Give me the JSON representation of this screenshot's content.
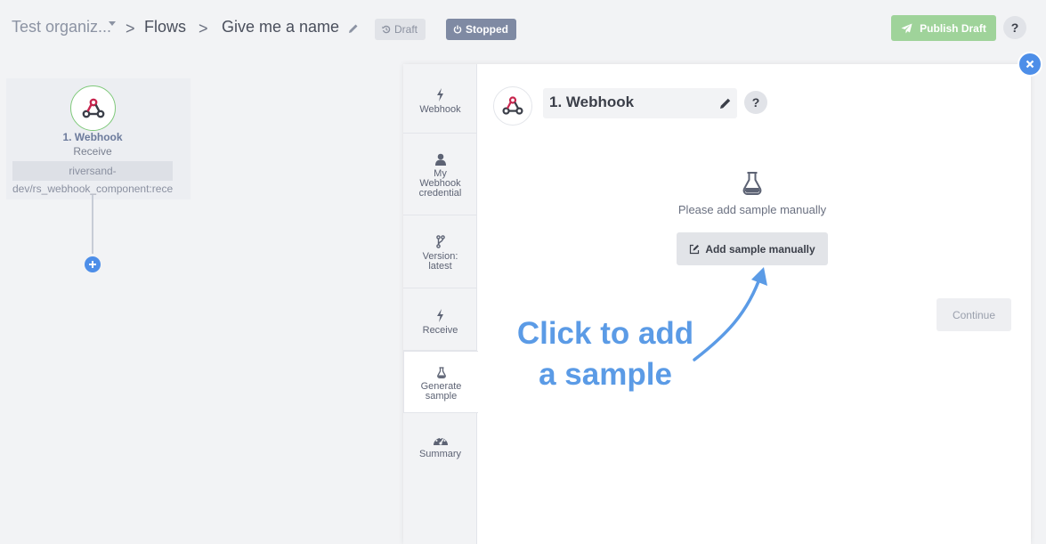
{
  "header": {
    "org": "Test organiz...",
    "sep": ">",
    "flows": "Flows",
    "flow_name": "Give me a name",
    "draft_label": "Draft",
    "stopped_label": "Stopped",
    "publish_label": "Publish Draft",
    "help_label": "?"
  },
  "canvas": {
    "node_title": "1. Webhook",
    "node_sub": "Receive",
    "node_comp_line1": "riversand-",
    "node_comp_line2": "dev/rs_webhook_component:receive"
  },
  "steps": [
    {
      "label": "Webhook",
      "icon": "bolt-icon"
    },
    {
      "label_lines": [
        "My",
        "Webhook",
        "credential"
      ],
      "icon": "user-icon"
    },
    {
      "label_lines": [
        "Version:",
        "latest"
      ],
      "icon": "branch-icon"
    },
    {
      "label": "Receive",
      "icon": "bolt-icon"
    },
    {
      "label_lines": [
        "Generate",
        "sample"
      ],
      "icon": "flask-icon",
      "active": true
    },
    {
      "label": "Summary",
      "icon": "dashboard-icon"
    }
  ],
  "panel": {
    "title": "1. Webhook",
    "help_label": "?",
    "sample_message": "Please add sample manually",
    "add_sample_label": "Add sample manually",
    "continue_label": "Continue"
  },
  "callout": {
    "line1": "Click to add",
    "line2": "a sample"
  },
  "colors": {
    "accent": "#4d8ee8",
    "publish": "#9fd39a",
    "stopped": "#7f8aa3",
    "callout": "#5b9be6"
  }
}
